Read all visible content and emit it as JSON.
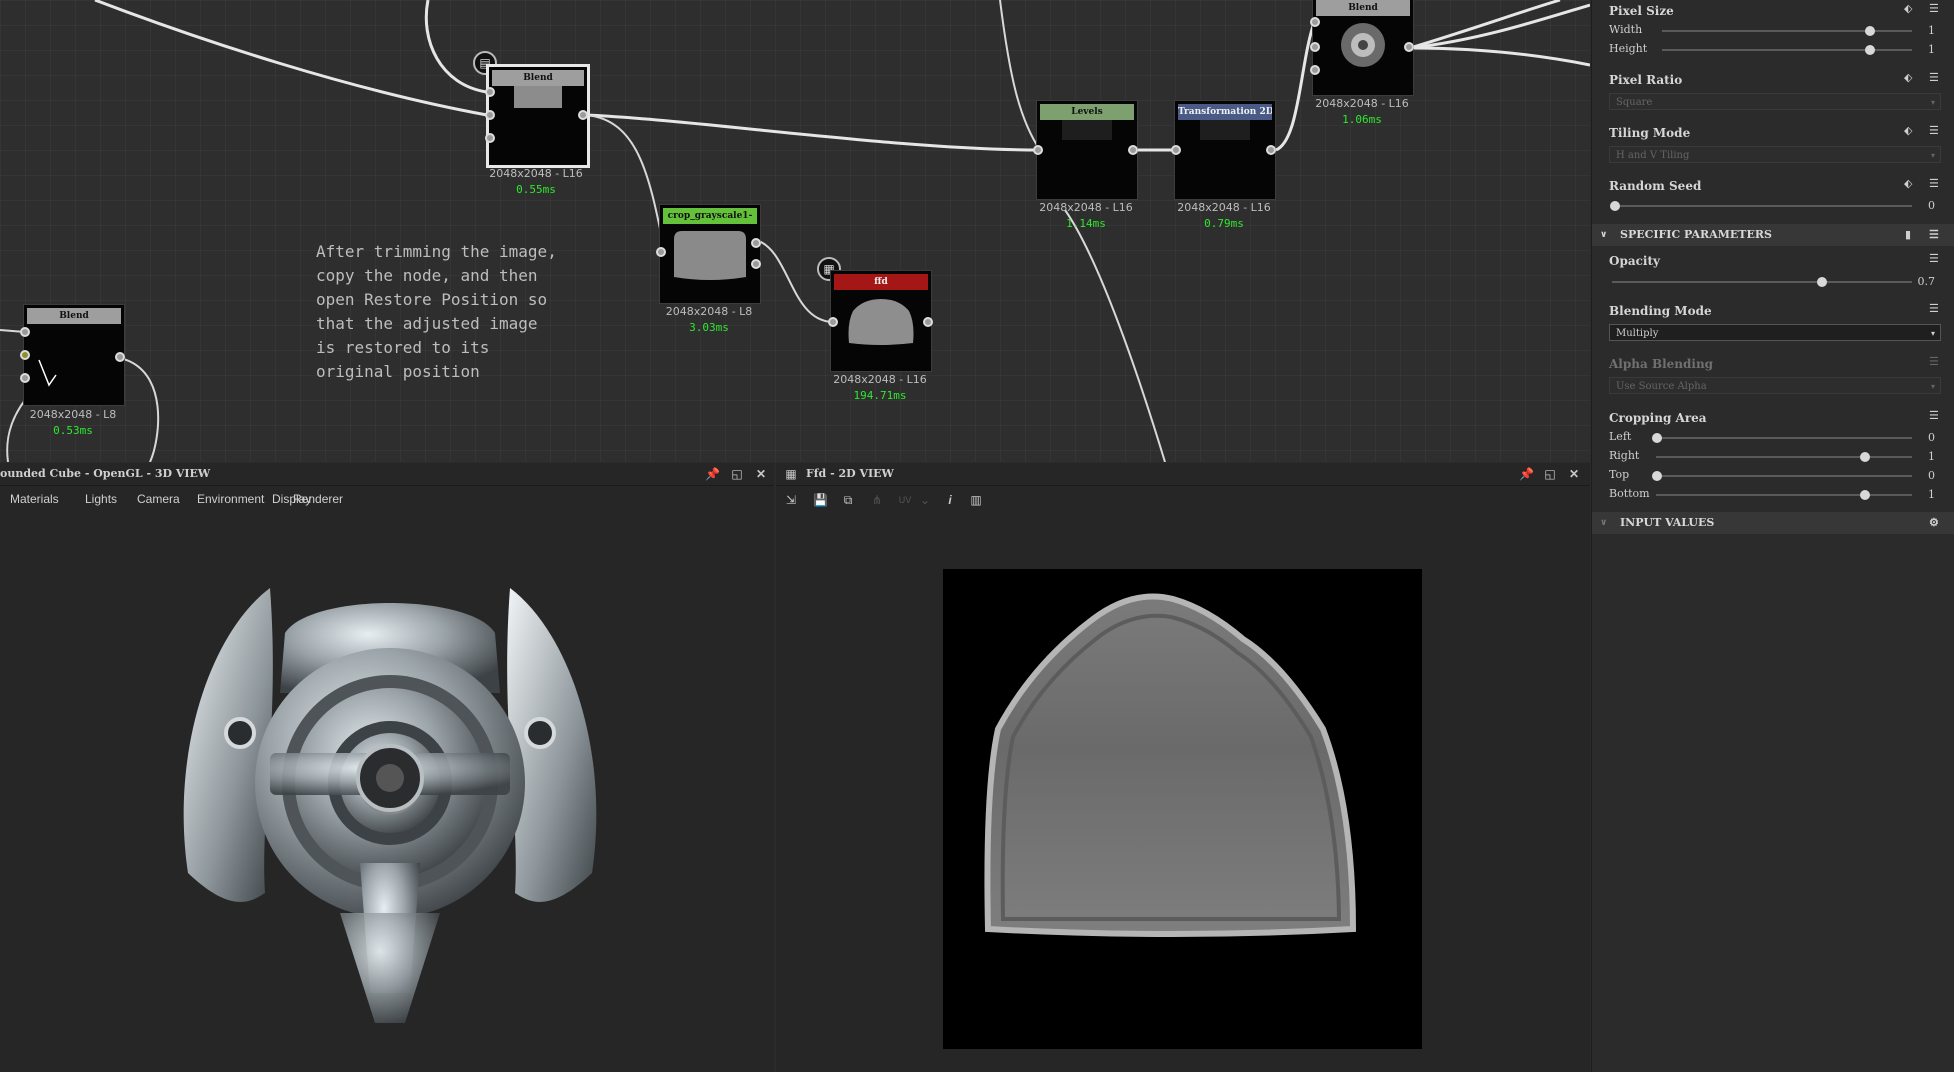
{
  "graph": {
    "comment": "After trimming the image,\ncopy the node, and then\nopen Restore Position so\nthat the adjusted image\nis restored to its\noriginal position",
    "nodes": [
      {
        "id": "blend-left",
        "title": "Blend",
        "size": "2048x2048 - L8",
        "time": "0.53ms",
        "color": "#9e9e9e"
      },
      {
        "id": "blend-main",
        "title": "Blend",
        "size": "2048x2048 - L16",
        "time": "0.55ms",
        "color": "#9e9e9e"
      },
      {
        "id": "crop",
        "title": "crop_grayscale1-",
        "size": "2048x2048 - L8",
        "time": "3.03ms",
        "color": "#63c23a"
      },
      {
        "id": "ffd",
        "title": "ffd",
        "size": "2048x2048 - L16",
        "time": "194.71ms",
        "color": "#a51616"
      },
      {
        "id": "levels",
        "title": "Levels",
        "size": "2048x2048 - L16",
        "time": "1.14ms",
        "color": "#7ea06e"
      },
      {
        "id": "transform",
        "title": "Transformation 2D",
        "size": "2048x2048 - L16",
        "time": "0.79ms",
        "color": "#4a5a86"
      },
      {
        "id": "blend-right",
        "title": "Blend",
        "size": "2048x2048 - L16",
        "time": "1.06ms",
        "color": "#9e9e9e"
      }
    ]
  },
  "view3d": {
    "title": "ounded Cube - OpenGL - 3D VIEW",
    "menu": [
      "Materials",
      "Lights",
      "Camera",
      "Environment",
      "Display",
      "Renderer"
    ]
  },
  "view2d": {
    "title": "Ffd - 2D VIEW",
    "uv_label": "UV"
  },
  "props": {
    "pixel_size": {
      "title": "Pixel Size",
      "width_label": "Width",
      "width_val": "1",
      "height_label": "Height",
      "height_val": "1"
    },
    "pixel_ratio": {
      "title": "Pixel Ratio",
      "value": "Square"
    },
    "tiling_mode": {
      "title": "Tiling Mode",
      "value": "H and V Tiling"
    },
    "random_seed": {
      "title": "Random Seed",
      "value": "0"
    },
    "specific": "SPECIFIC PARAMETERS",
    "opacity": {
      "title": "Opacity",
      "value": "0.7",
      "level": 0.7
    },
    "blending_mode": {
      "title": "Blending Mode",
      "value": "Multiply"
    },
    "alpha_blending": {
      "title": "Alpha Blending",
      "value": "Use Source Alpha"
    },
    "cropping": {
      "title": "Cropping Area",
      "rows": [
        {
          "label": "Left",
          "value": "0",
          "level": 0
        },
        {
          "label": "Right",
          "value": "1",
          "level": 1
        },
        {
          "label": "Top",
          "value": "0",
          "level": 0
        },
        {
          "label": "Bottom",
          "value": "1",
          "level": 1
        }
      ]
    },
    "input_values": "INPUT VALUES"
  }
}
